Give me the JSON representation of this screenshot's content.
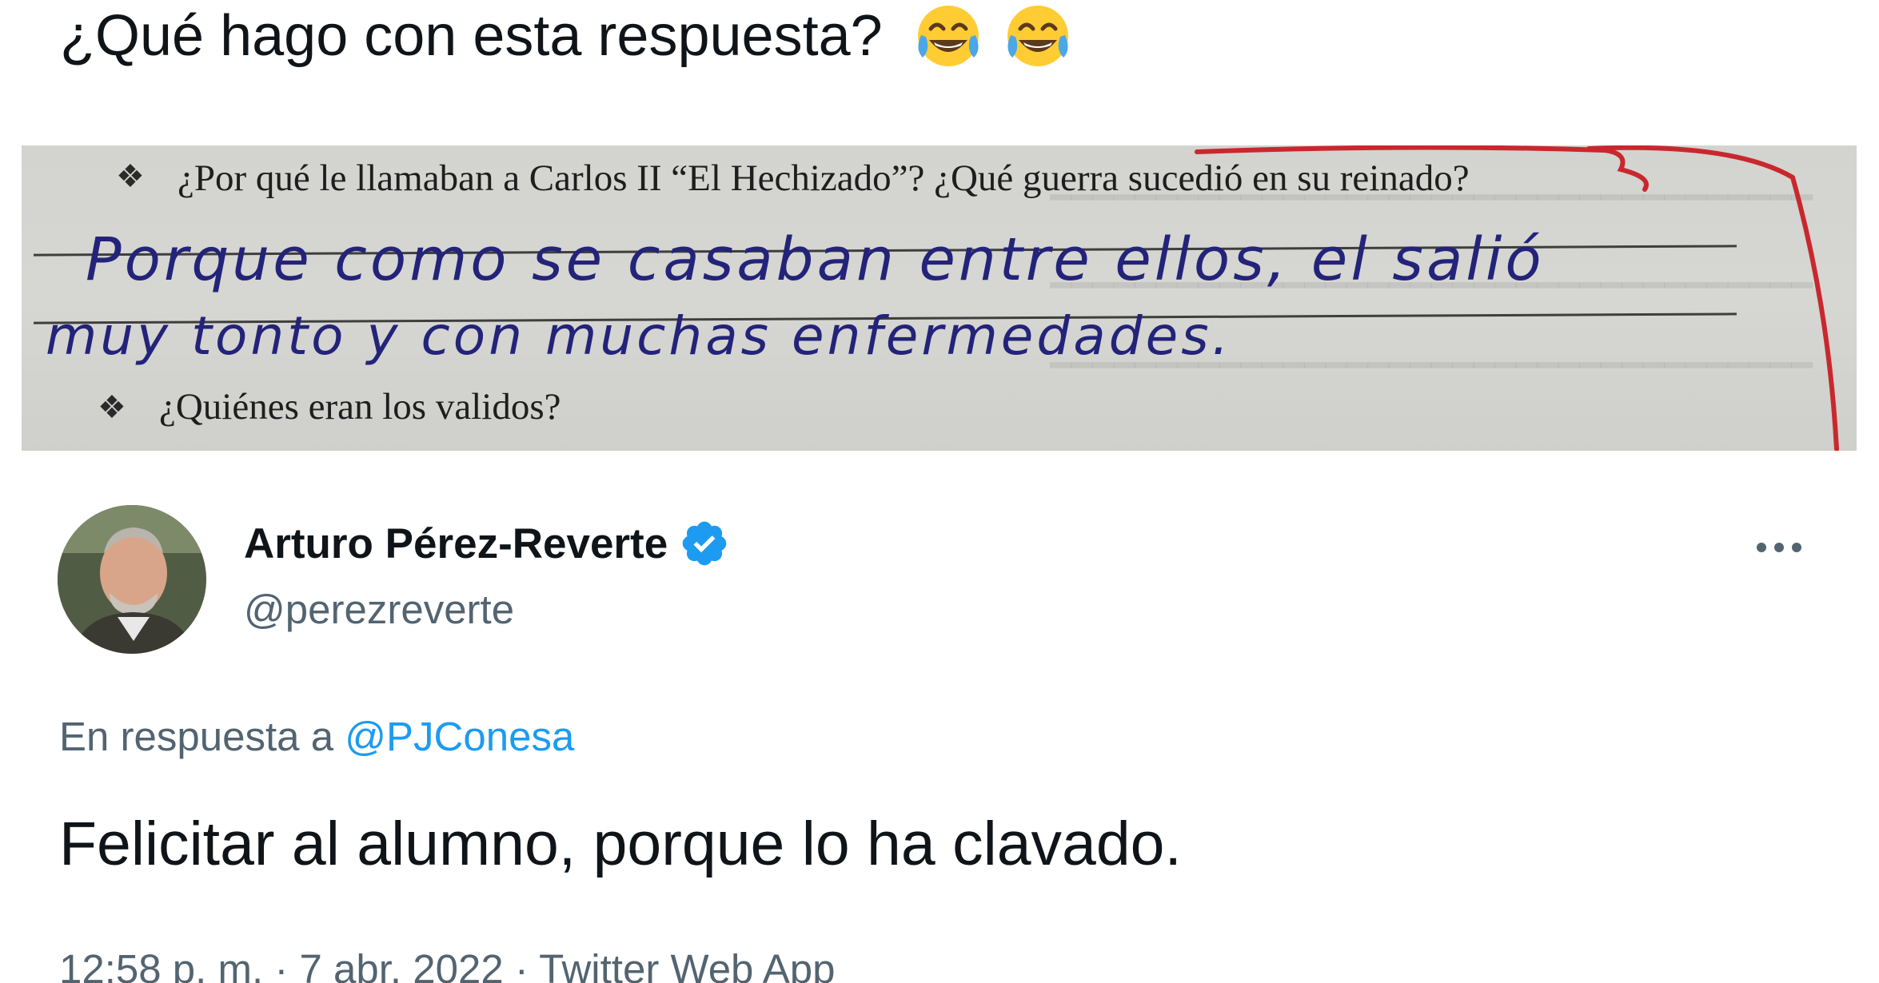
{
  "quoted_tweet": {
    "text": "¿Qué hago con esta respuesta?",
    "emojis": [
      "face-with-tears-of-joy-icon",
      "face-with-tears-of-joy-icon"
    ]
  },
  "photo": {
    "question_1": "¿Por qué le llamaban a Carlos II “El Hechizado”? ¿Qué guerra sucedió en su reinado?",
    "handwritten_line_1": "Porque como se casaban entre ellos, el salió",
    "handwritten_line_2": "muy tonto y con muchas enfermedades.",
    "question_2": "¿Quiénes eran los validos?"
  },
  "tweet": {
    "author_name": "Arturo Pérez-Reverte",
    "handle": "@perezreverte",
    "verified": true,
    "reply_prefix": "En respuesta a",
    "reply_to": "@PJConesa",
    "body": "Felicitar al alumno, porque lo ha clavado.",
    "time": "12:58 p. m.",
    "separator": "·",
    "date": "7 abr. 2022",
    "source": "Twitter Web App"
  },
  "colors": {
    "text_primary": "#0f1419",
    "text_secondary": "#536471",
    "link": "#1d9bf0",
    "verified_badge": "#1d9bf0",
    "ink_blue": "#23237a",
    "teacher_red": "#c8282d"
  }
}
